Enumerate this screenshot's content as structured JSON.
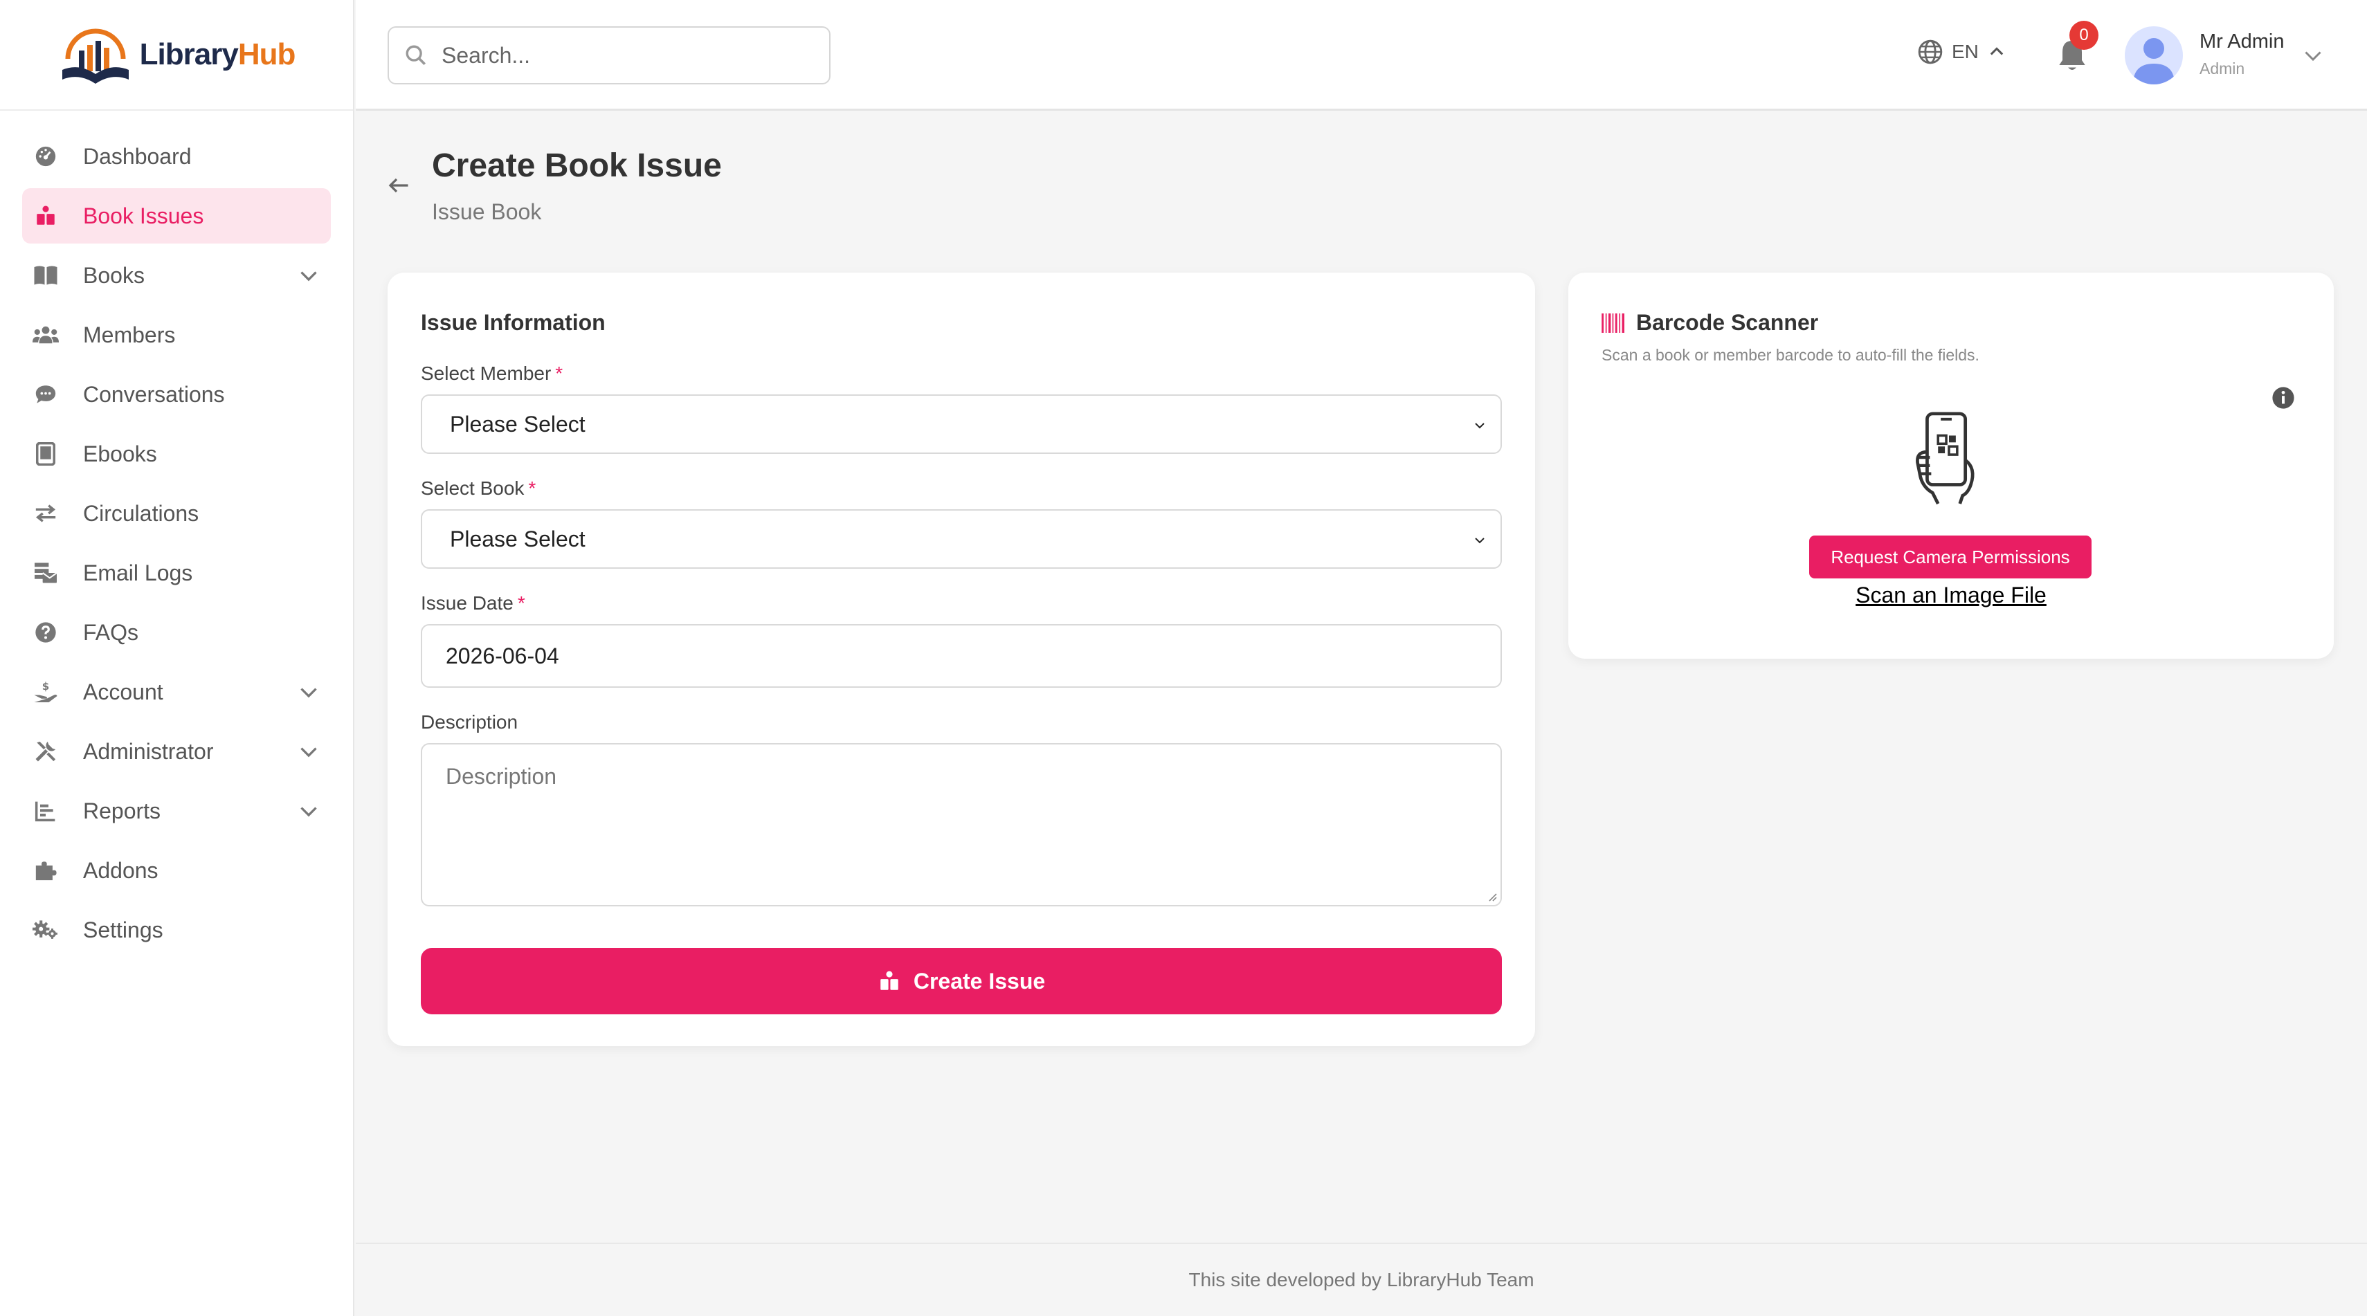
{
  "app": {
    "logo_part1": "Library",
    "logo_part2": "Hub"
  },
  "sidebar": {
    "items": [
      {
        "label": "Dashboard",
        "icon": "dashboard-icon"
      },
      {
        "label": "Book Issues",
        "icon": "book-issue-icon",
        "active": true
      },
      {
        "label": "Books",
        "icon": "book-open-icon",
        "expandable": true
      },
      {
        "label": "Members",
        "icon": "users-icon"
      },
      {
        "label": "Conversations",
        "icon": "chat-icon"
      },
      {
        "label": "Ebooks",
        "icon": "tablet-icon"
      },
      {
        "label": "Circulations",
        "icon": "exchange-icon"
      },
      {
        "label": "Email Logs",
        "icon": "mail-log-icon"
      },
      {
        "label": "FAQs",
        "icon": "question-icon"
      },
      {
        "label": "Account",
        "icon": "hand-dollar-icon",
        "expandable": true
      },
      {
        "label": "Administrator",
        "icon": "tools-icon",
        "expandable": true
      },
      {
        "label": "Reports",
        "icon": "chart-icon",
        "expandable": true
      },
      {
        "label": "Addons",
        "icon": "puzzle-icon"
      },
      {
        "label": "Settings",
        "icon": "gears-icon"
      }
    ]
  },
  "topbar": {
    "search_placeholder": "Search...",
    "language": "EN",
    "notification_count": "0",
    "user_name": "Mr Admin",
    "user_role": "Admin"
  },
  "page": {
    "title": "Create Book Issue",
    "subtitle": "Issue Book"
  },
  "form": {
    "card_title": "Issue Information",
    "member_label": "Select Member",
    "member_value": "Please Select",
    "book_label": "Select Book",
    "book_value": "Please Select",
    "date_label": "Issue Date",
    "date_value": "2026-06-04",
    "description_label": "Description",
    "description_placeholder": "Description",
    "submit_label": "Create Issue",
    "required_mark": "*"
  },
  "scanner": {
    "title": "Barcode Scanner",
    "subtitle": "Scan a book or member barcode to auto-fill the fields.",
    "camera_button": "Request Camera Permissions",
    "scan_file_link": "Scan an Image File"
  },
  "footer": {
    "text": "This site developed by LibraryHub Team"
  },
  "colors": {
    "accent": "#e91e63",
    "accent_light": "#fde4ec",
    "logo_dark": "#1e2a4a",
    "logo_orange": "#e8761b",
    "badge": "#e53935"
  }
}
